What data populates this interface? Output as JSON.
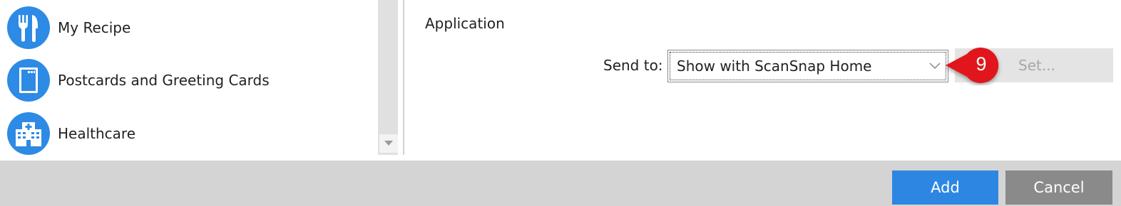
{
  "profiles": [
    {
      "label": "My Recipe",
      "icon": "fork-knife-icon"
    },
    {
      "label": "Postcards and Greeting Cards",
      "icon": "postcard-icon"
    },
    {
      "label": "Healthcare",
      "icon": "hospital-icon"
    }
  ],
  "settings": {
    "section_title": "Application",
    "send_to_label": "Send to:",
    "send_to_value": "Show with ScanSnap Home",
    "set_button_label": "Set..."
  },
  "callout": {
    "number": "9"
  },
  "footer": {
    "add_label": "Add",
    "cancel_label": "Cancel"
  },
  "colors": {
    "accent": "#2d87e2",
    "callout_red": "#e0141e",
    "cancel_gray": "#8a8a8a",
    "footer_bg": "#d4d4d4"
  }
}
